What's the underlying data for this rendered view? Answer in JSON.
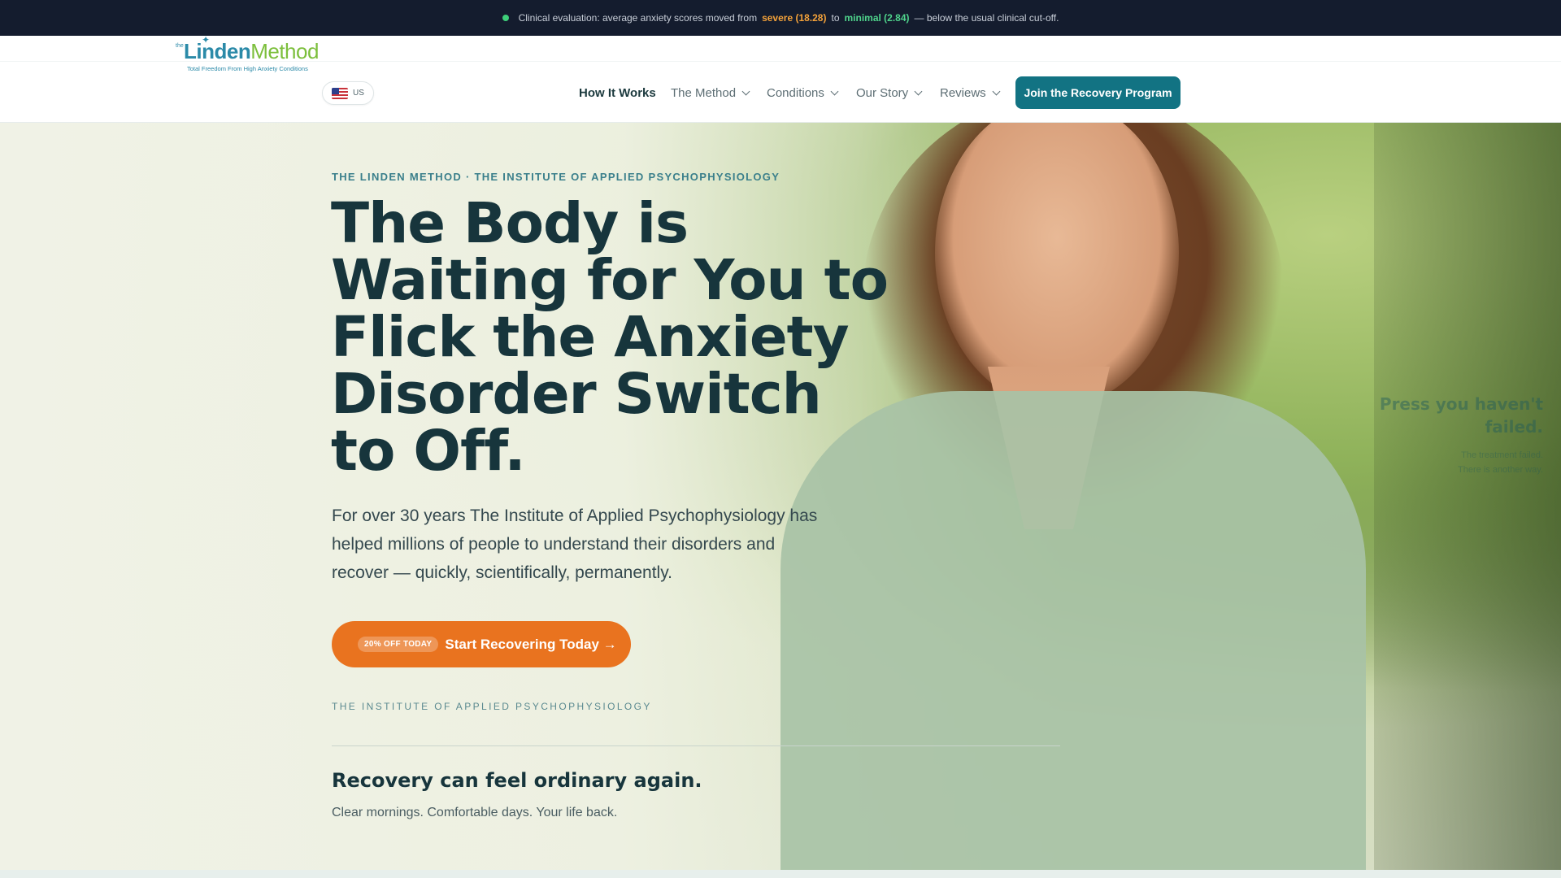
{
  "topbar": {
    "prefix": "Clinical evaluation: average anxiety scores moved from",
    "severe": "severe (18.28)",
    "to": "to",
    "minimal": "minimal (2.84)",
    "suffix": "— below the usual clinical cut-off."
  },
  "logo": {
    "the": "the",
    "linden": "Linden",
    "method": "Method",
    "tagline": "Total Freedom From High Anxiety Conditions"
  },
  "region": {
    "code": "US"
  },
  "nav": {
    "items": [
      {
        "label": "How It Works"
      },
      {
        "label": "The Method"
      },
      {
        "label": "Conditions"
      },
      {
        "label": "Our Story"
      },
      {
        "label": "Reviews"
      }
    ],
    "cta": "Join the Recovery Program"
  },
  "hero": {
    "brandline": "THE LINDEN METHOD · THE INSTITUTE OF APPLIED PSYCHOPHYSIOLOGY",
    "title": "The Body is Waiting for You to Flick the Anxiety Disorder Switch to Off.",
    "lede": "For over 30 years The Institute of Applied Psychophysiology has helped millions of people to understand their disorders and recover — quickly, scientifically, permanently.",
    "cta_badge": "20% OFF TODAY",
    "cta_label": "Start Recovering Today →",
    "institute": "THE INSTITUTE OF APPLIED PSYCHOPHYSIOLOGY",
    "subheading": "Recovery can feel ordinary again.",
    "subline": "Clear mornings. Comfortable days. Your life back.",
    "ghost_heading_1": "Press you haven't",
    "ghost_heading_2": "failed.",
    "ghost_small_1": "The treatment failed.",
    "ghost_small_2": "There is another way."
  },
  "colors": {
    "topbar_bg": "#141c2e",
    "accent_teal": "#127383",
    "cta_orange": "#e9731f",
    "heading": "#17353c"
  }
}
